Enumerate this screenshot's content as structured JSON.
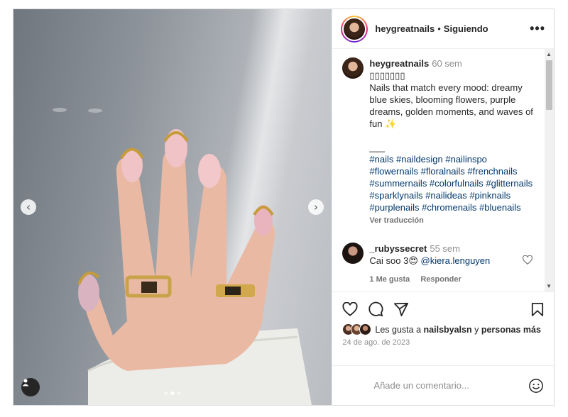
{
  "post": {
    "username": "heygreatnails",
    "separator": "•",
    "follow_status": "Siguiendo",
    "more_icon": "more-horizontal-icon",
    "caption_time": "60 sem",
    "caption_emoji_line": "▯▯▯▯▯▯▯",
    "caption_text": "Nails that match every mood: dreamy blue skies, blooming flowers, purple dreams, golden moments, and waves of fun ✨",
    "caption_divider": "___",
    "hashtags": "#nails #naildesign #nailinspo #flowernails #floralnails #frenchnails #summernails #colorfulnails #glitternails #sparklynails #nailideas #pinknails #purplenails #chromenails #bluenails",
    "translate_label": "Ver traducción"
  },
  "comment": {
    "username": "_rubyssecret",
    "time": "55 sem",
    "text": "Cai soo 3😍",
    "mention": "@kiera.lenguyen",
    "likes_label": "1 Me gusta",
    "reply_label": "Responder"
  },
  "footer": {
    "likes_prefix": "Les gusta a",
    "likes_user": "nailsbyalsn",
    "likes_joiner": "y",
    "likes_suffix": "personas más",
    "date": "24 de ago. de 2023",
    "comment_placeholder": "Añade un comentario..."
  },
  "carousel": {
    "prev": "‹",
    "next": "›",
    "dots_count": 3,
    "active_dot": 2
  },
  "colors": {
    "link": "#00376b",
    "muted": "#8e8e8e",
    "text": "#262626"
  }
}
